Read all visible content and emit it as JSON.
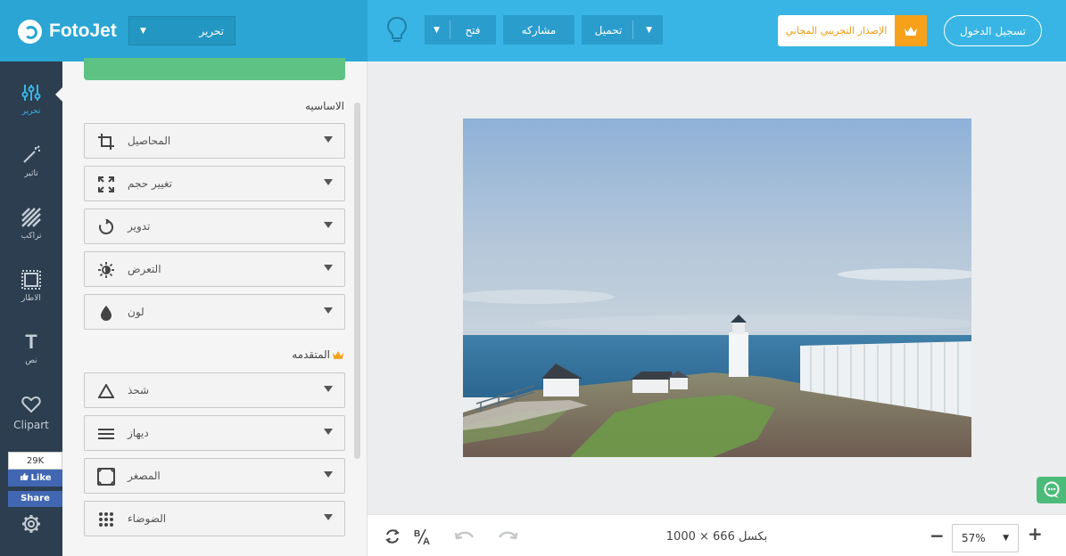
{
  "header": {
    "logo": "FotoJet",
    "mode_select": "تحرير",
    "open_label": "فتح",
    "share_label": "مشاركه",
    "download_label": "تحميل",
    "trial_label": "الإصدار التجريبي المجاني",
    "login_label": "تسجيل الدخول"
  },
  "rail": {
    "items": [
      {
        "label": "تحرير",
        "icon": "sliders-icon",
        "active": true
      },
      {
        "label": "تاثير",
        "icon": "magic-wand-icon"
      },
      {
        "label": "تراكب",
        "icon": "overlay-stripes-icon"
      },
      {
        "label": "الاطار",
        "icon": "frame-icon"
      },
      {
        "label": "نص",
        "icon": "text-icon"
      },
      {
        "label": "Clipart",
        "icon": "heart-icon"
      }
    ],
    "fb_count": "29K",
    "fb_like": "Like",
    "fb_share": "Share",
    "settings_icon": "gear-icon"
  },
  "panel": {
    "basic_title": "الاساسيه",
    "advanced_title": "المتقدمه",
    "basic_tools": [
      {
        "label": "المحاصيل",
        "icon": "crop-icon"
      },
      {
        "label": "تغيير حجم",
        "icon": "resize-icon"
      },
      {
        "label": "تدوير",
        "icon": "rotate-icon"
      },
      {
        "label": "التعرض",
        "icon": "brightness-icon"
      },
      {
        "label": "لون",
        "icon": "color-drop-icon"
      }
    ],
    "advanced_tools": [
      {
        "label": "شحذ",
        "icon": "triangle-icon"
      },
      {
        "label": "ديهاز",
        "icon": "dehaze-lines-icon"
      },
      {
        "label": "المصغر",
        "icon": "vignette-icon"
      },
      {
        "label": "الضوضاء",
        "icon": "noise-dots-icon"
      }
    ]
  },
  "bottombar": {
    "dimensions": "1000 × 666 بكسل",
    "zoom": "57%"
  },
  "colors": {
    "header": "#38b5e4",
    "header_left": "#2aa5d4",
    "rail": "#2c3e50",
    "accent": "#38b5e4",
    "trial_orange": "#f7a11a",
    "green": "#5ec285"
  }
}
